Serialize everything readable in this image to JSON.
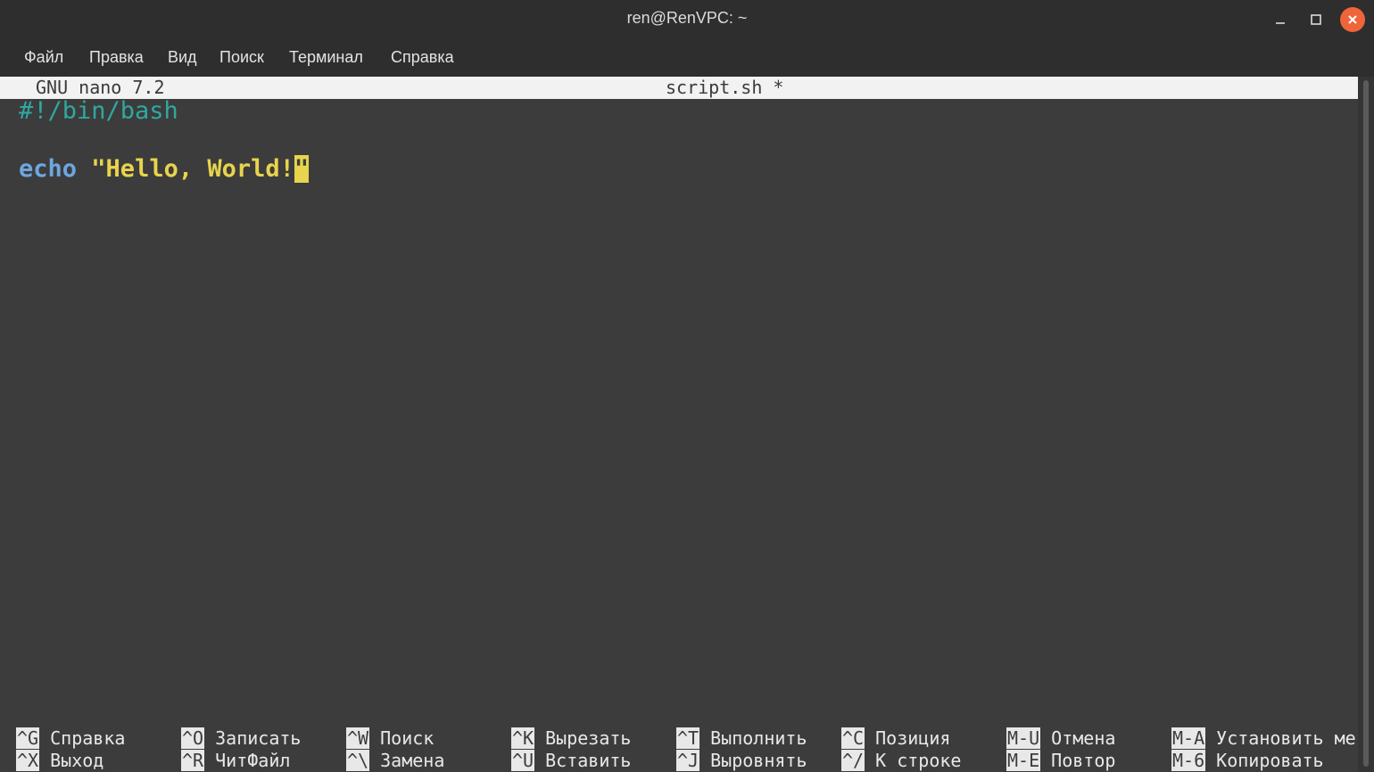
{
  "window": {
    "title": "ren@RenVPC: ~",
    "controls": {
      "minimize": "–",
      "maximize": "☐",
      "close": "✕"
    }
  },
  "menu": [
    "Файл",
    "Правка",
    "Вид",
    "Поиск",
    "Терминал",
    "Справка"
  ],
  "nano": {
    "version": "GNU nano 7.2",
    "filename": "script.sh *"
  },
  "editor": {
    "line1": "#!/bin/bash",
    "line2_keyword": "echo",
    "line2_string": "\"Hello, World!",
    "line2_cursor_char": "\""
  },
  "shortcuts": {
    "row1": [
      {
        "key": "^G",
        "label": "Справка"
      },
      {
        "key": "^O",
        "label": "Записать"
      },
      {
        "key": "^W",
        "label": "Поиск"
      },
      {
        "key": "^K",
        "label": "Вырезать"
      },
      {
        "key": "^T",
        "label": "Выполнить"
      },
      {
        "key": "^C",
        "label": "Позиция"
      },
      {
        "key": "M-U",
        "label": "Отмена"
      },
      {
        "key": "M-A",
        "label": "Установить мет"
      }
    ],
    "row2": [
      {
        "key": "^X",
        "label": "Выход"
      },
      {
        "key": "^R",
        "label": "ЧитФайл"
      },
      {
        "key": "^\\",
        "label": "Замена"
      },
      {
        "key": "^U",
        "label": "Вставить"
      },
      {
        "key": "^J",
        "label": "Выровнять"
      },
      {
        "key": "^/",
        "label": "К строке"
      },
      {
        "key": "M-E",
        "label": "Повтор"
      },
      {
        "key": "M-6",
        "label": "Копировать"
      }
    ]
  },
  "colors": {
    "comment": "#2fa8a0",
    "keyword": "#6ea6e0",
    "string": "#e8d44d",
    "close_button": "#f0643a"
  }
}
